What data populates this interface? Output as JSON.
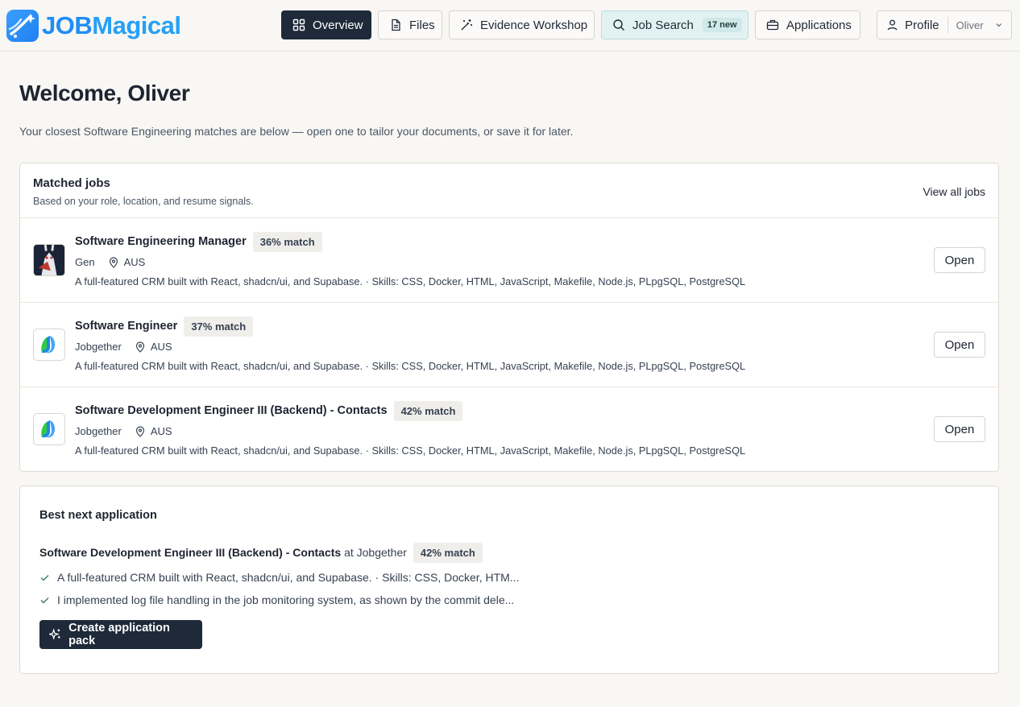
{
  "brand": {
    "part1": "JOB",
    "part2": "Magical",
    "logo_icon": "rocket-star-icon"
  },
  "nav": {
    "overview": "Overview",
    "files": "Files",
    "evidence": "Evidence Workshop",
    "job_search": "Job Search",
    "job_search_badge": "17 new",
    "applications": "Applications"
  },
  "profile": {
    "label": "Profile",
    "user": "Oliver"
  },
  "page": {
    "title": "Welcome, Oliver",
    "subtitle": "Your closest Software Engineering matches are below — open one to tailor your documents, or save it for later."
  },
  "matched": {
    "title": "Matched jobs",
    "subtitle": "Based on your role, location, and resume signals.",
    "view_all": "View all jobs",
    "open_label": "Open",
    "jobs": [
      {
        "title": "Software Engineering Manager",
        "match": "36% match",
        "company": "Gen",
        "location": "AUS",
        "description": "A full-featured CRM built with React, shadcn/ui, and Supabase. · Skills: CSS, Docker, HTML, JavaScript, Makefile, Node.js, PLpgSQL, PostgreSQL"
      },
      {
        "title": "Software Engineer",
        "match": "37% match",
        "company": "Jobgether",
        "location": "AUS",
        "description": "A full-featured CRM built with React, shadcn/ui, and Supabase. · Skills: CSS, Docker, HTML, JavaScript, Makefile, Node.js, PLpgSQL, PostgreSQL"
      },
      {
        "title": "Software Development Engineer III (Backend) - Contacts",
        "match": "42% match",
        "company": "Jobgether",
        "location": "AUS",
        "description": "A full-featured CRM built with React, shadcn/ui, and Supabase. · Skills: CSS, Docker, HTML, JavaScript, Makefile, Node.js, PLpgSQL, PostgreSQL"
      }
    ]
  },
  "best": {
    "title": "Best next application",
    "job_title": "Software Development Engineer III (Backend) - Contacts",
    "at": "at Jobgether",
    "match": "42% match",
    "points": [
      "A full-featured CRM built with React, shadcn/ui, and Supabase. · Skills: CSS, Docker, HTM...",
      "I implemented log file handling in the job monitoring system, as shown by the commit dele..."
    ],
    "cta": "Create application pack"
  },
  "colors": {
    "accent_dark": "#1e2a39",
    "brand_blue": "#1f8df6",
    "search_bg": "#e2f2f2",
    "page_bg": "#f8f7f4"
  }
}
